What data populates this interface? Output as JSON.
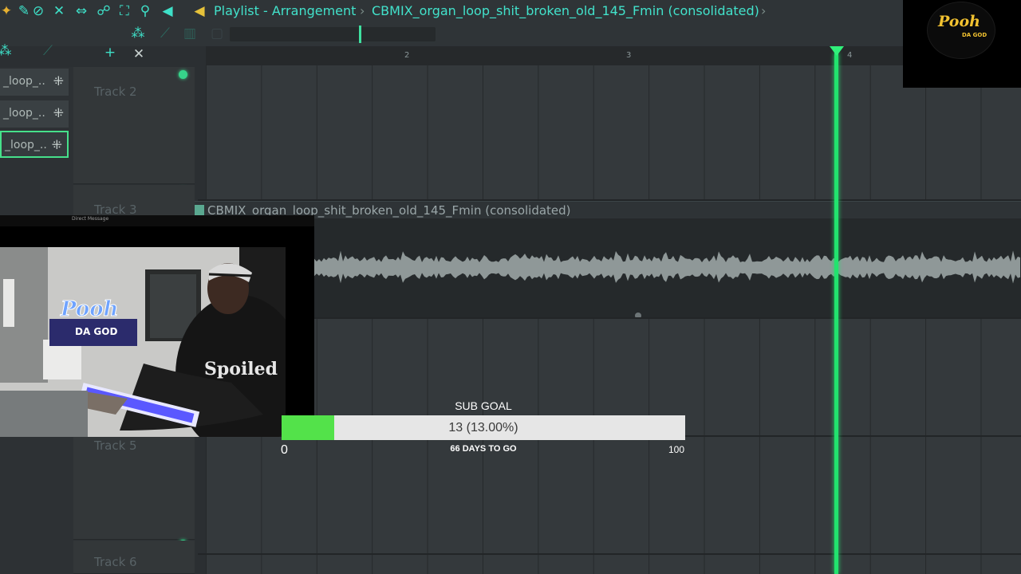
{
  "toolbar": {
    "title": "Playlist - Arrangement",
    "separator": "›",
    "clip_name": "CBMIX_organ_loop_shit_broken_old_145_Fmin (consolidated)",
    "end_arrow": "›",
    "accent_color": "#42e2cb"
  },
  "picker": {
    "patterns": [
      {
        "label": "_loop_..",
        "selected": false
      },
      {
        "label": "_loop_..",
        "selected": false
      },
      {
        "label": "_loop_..",
        "selected": true
      }
    ]
  },
  "timeline": {
    "bars": [
      "2",
      "3",
      "4"
    ]
  },
  "tracks": [
    {
      "name": "Track 2"
    },
    {
      "name": "Track 3"
    },
    {
      "name": "Track 5"
    },
    {
      "name": "Track 6"
    }
  ],
  "clip": {
    "title": "CBMIX_organ_loop_shit_broken_old_145_Fmin (consolidated)"
  },
  "playhead": {
    "color": "#22e36e"
  },
  "logo": {
    "text": "Pooh",
    "sub": "DA GOD"
  },
  "webcam": {
    "bar_title": "Direct Message",
    "shirt_text": "Spoiled"
  },
  "sub_goal": {
    "title": "SUB GOAL",
    "value_text": "13 (13.00%)",
    "current": 13,
    "target": 100,
    "min_label": "0",
    "max_label": "100",
    "days_label": "66 DAYS TO GO",
    "fill_color": "#53e24a"
  }
}
